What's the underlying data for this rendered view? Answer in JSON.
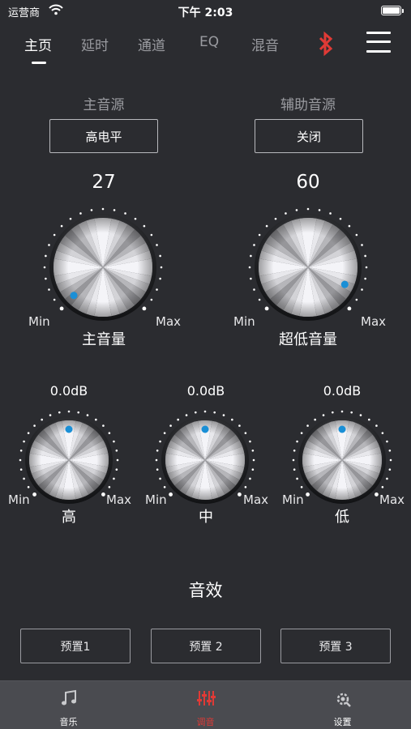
{
  "status_bar": {
    "carrier": "运营商",
    "time": "下午 2:03"
  },
  "nav": {
    "tabs": [
      {
        "label": "主页",
        "active": true
      },
      {
        "label": "延时",
        "active": false
      },
      {
        "label": "通道",
        "active": false
      },
      {
        "label": "EQ",
        "active": false
      },
      {
        "label": "混音",
        "active": false
      }
    ],
    "bluetooth_icon": "bluetooth-icon",
    "menu_icon": "hamburger-menu-icon",
    "bluetooth_color": "#e03a36"
  },
  "sources": {
    "main": {
      "label": "主音源",
      "value": "高电平"
    },
    "aux": {
      "label": "辅助音源",
      "value": "关闭"
    }
  },
  "knobs": {
    "master": {
      "value": "27",
      "label": "主音量",
      "min": "Min",
      "max": "Max"
    },
    "sub": {
      "value": "60",
      "label": "超低音量",
      "min": "Min",
      "max": "Max"
    },
    "high": {
      "value": "0.0dB",
      "label": "高",
      "min": "Min",
      "max": "Max"
    },
    "mid": {
      "value": "0.0dB",
      "label": "中",
      "min": "Min",
      "max": "Max"
    },
    "low": {
      "value": "0.0dB",
      "label": "低",
      "min": "Min",
      "max": "Max"
    }
  },
  "effects": {
    "title": "音效",
    "presets": [
      "预置1",
      "预置 2",
      "预置 3"
    ]
  },
  "bottom_bar": {
    "items": [
      {
        "label": "音乐",
        "icon": "music-note-icon",
        "active": false
      },
      {
        "label": "调音",
        "icon": "equalizer-sliders-icon",
        "active": true
      },
      {
        "label": "设置",
        "icon": "settings-gear-icon",
        "active": false
      }
    ],
    "active_color": "#e03a36"
  },
  "colors": {
    "background": "#2b2c30",
    "indicator": "#1a8fd6"
  }
}
